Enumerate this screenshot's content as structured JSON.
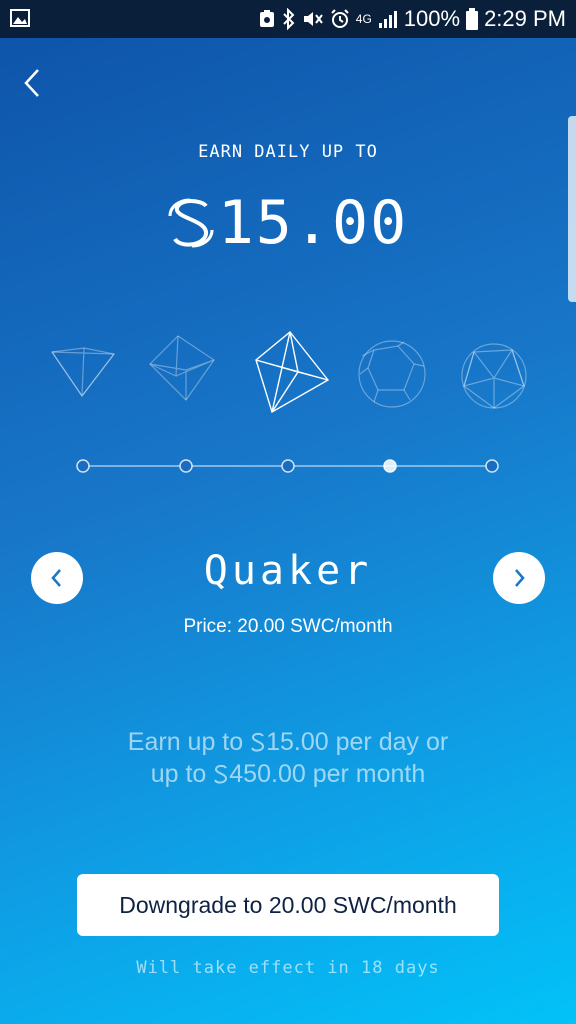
{
  "status_bar": {
    "network": "4G",
    "battery": "100%",
    "time": "2:29 PM"
  },
  "header": {
    "earn_label": "EARN DAILY UP TO",
    "amount": "15.00"
  },
  "tier_selector": {
    "levels": [
      {
        "shape": "pyramid-icon",
        "active": false
      },
      {
        "shape": "cube-icon",
        "active": false
      },
      {
        "shape": "octahedron-icon",
        "active": true
      },
      {
        "shape": "dodecahedron-icon",
        "active": false
      },
      {
        "shape": "icosahedron-icon",
        "active": false
      }
    ],
    "selected_index": 3
  },
  "tier": {
    "name": "Quaker",
    "price": "Price: 20.00 SWC/month"
  },
  "earn_description": {
    "line1_prefix": "Earn up to ",
    "line1_amount": "15.00",
    "line1_suffix": " per day or",
    "line2_prefix": "up to ",
    "line2_amount": "450.00",
    "line2_suffix": " per month"
  },
  "cta": {
    "label": "Downgrade to 20.00 SWC/month"
  },
  "effect_note": "Will take effect in 18 days",
  "colors": {
    "bg_top": "#0d52a8",
    "bg_bottom": "#02c2f8",
    "nav_arrow": "#1877c9",
    "button_text": "#0f2244"
  }
}
